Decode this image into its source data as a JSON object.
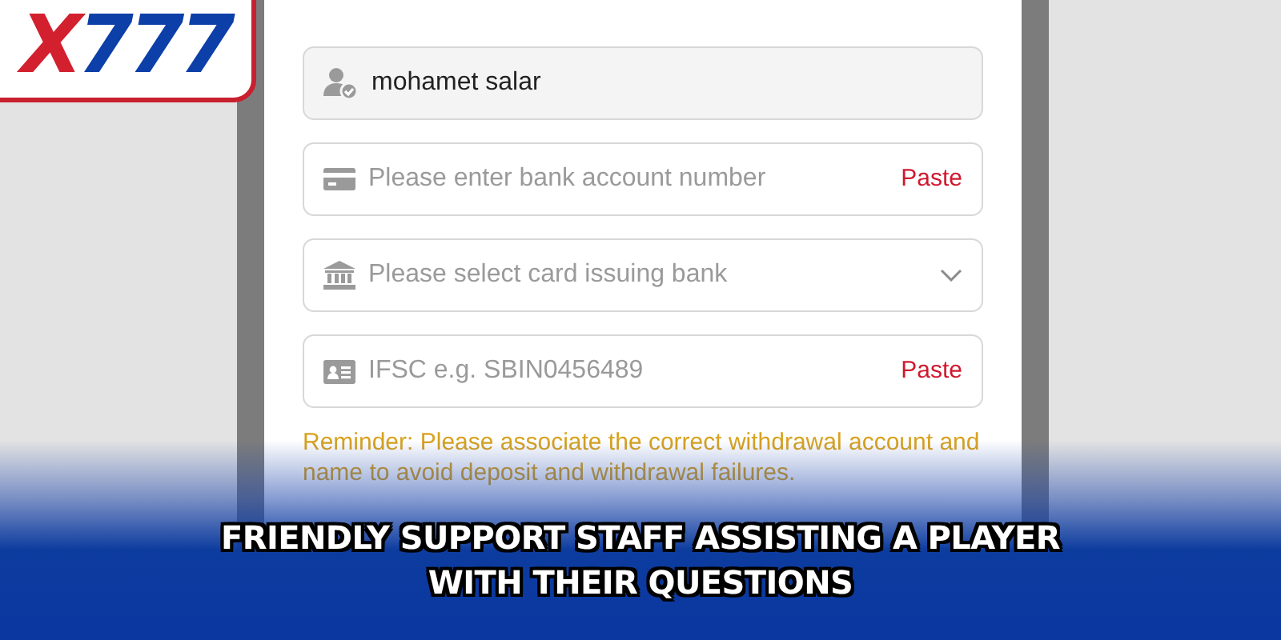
{
  "logo": [
    "X",
    "777"
  ],
  "fields": [
    {
      "kind": "text",
      "value": "mohamet salar"
    },
    {
      "kind": "input",
      "placeholder": "Please enter bank account number",
      "action": "Paste"
    },
    {
      "kind": "select",
      "placeholder": "Please select card issuing bank"
    },
    {
      "kind": "input",
      "placeholder": "IFSC e.g. SBIN0456489",
      "action": "Paste"
    }
  ],
  "reminder": "Reminder: Please associate the correct withdrawal account and name to avoid deposit and withdrawal failures.",
  "caption": [
    "FRIENDLY SUPPORT STAFF ASSISTING A PLAYER",
    "WITH THEIR QUESTIONS"
  ]
}
